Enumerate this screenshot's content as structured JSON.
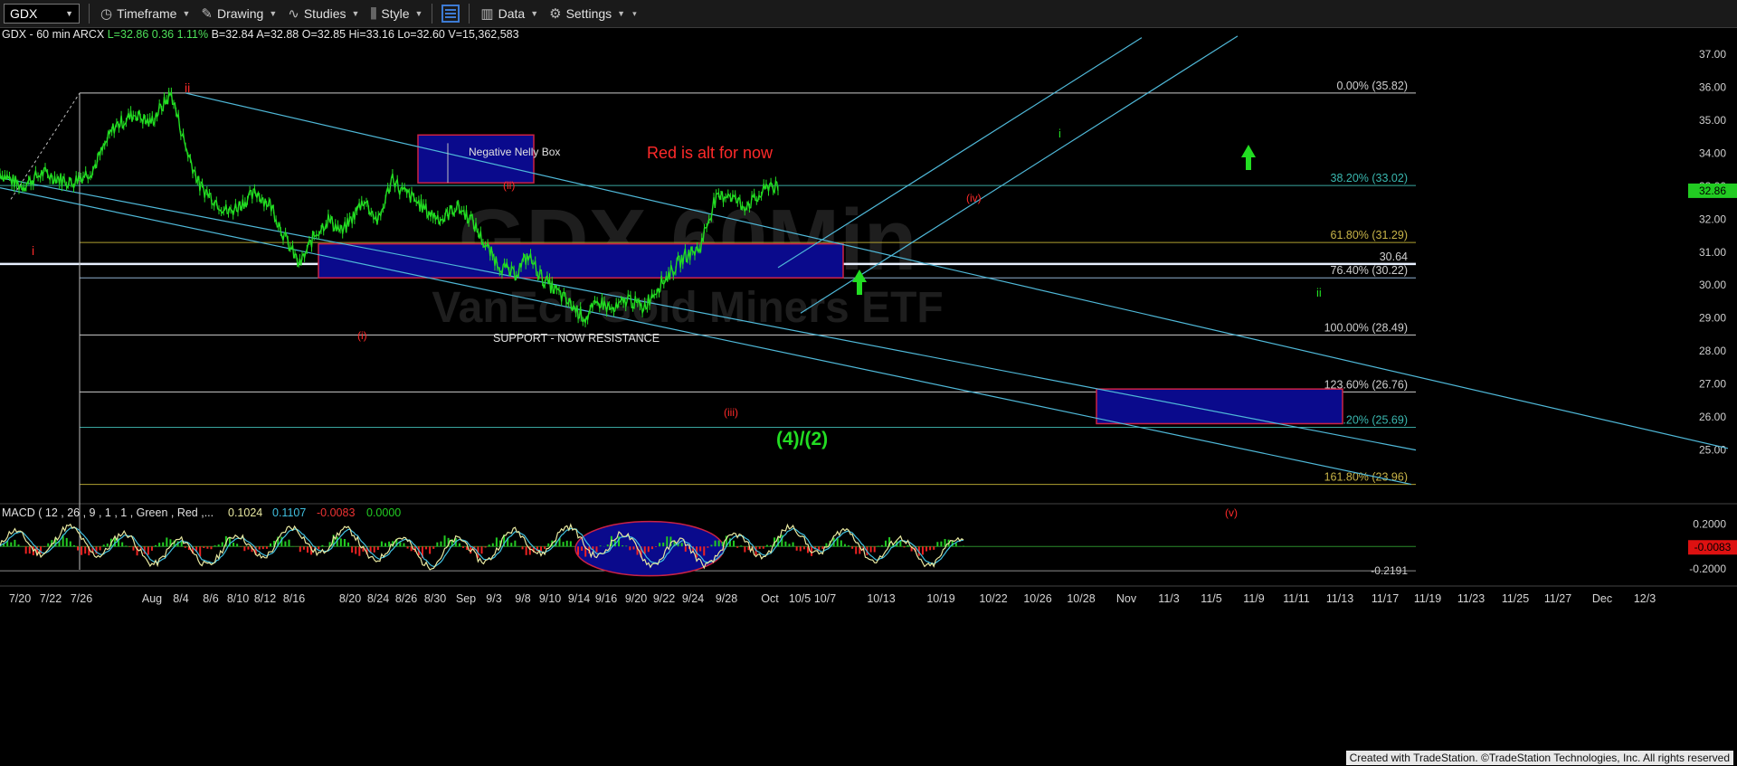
{
  "toolbar": {
    "symbol": "GDX",
    "timeframe": "Timeframe",
    "drawing": "Drawing",
    "studies": "Studies",
    "style": "Style",
    "data": "Data",
    "settings": "Settings"
  },
  "header": {
    "instrument": "GDX - 60 min",
    "exchange": "ARCX",
    "last": "L=32.86",
    "change": "0.36",
    "pct": "1.11%",
    "bid": "B=32.84",
    "ask": "A=32.88",
    "open": "O=32.85",
    "high": "Hi=33.16",
    "low": "Lo=32.60",
    "volume": "V=15,362,583"
  },
  "colors": {
    "price": "#22dd22",
    "wave_red": "#ff2a2a",
    "wave_green": "#22dd22",
    "channel": "#4fb8d8",
    "box_fill": "#0a0a8c",
    "box_border": "#cc2244",
    "macd_hist_pos": "#22cc22",
    "macd_hist_neg": "#ee2222",
    "macd_line": "#e8e8a0",
    "signal_line": "#40c0e0"
  },
  "watermark": {
    "line1": "GDX 60Min",
    "line2": "VanEck Gold Miners ETF"
  },
  "chart_data": {
    "type": "line",
    "title": "GDX - 60 min",
    "ylim": [
      23.4,
      37.6
    ],
    "y_ticks": [
      "37.00",
      "36.00",
      "35.00",
      "34.00",
      "33.00",
      "32.00",
      "31.00",
      "30.00",
      "29.00",
      "28.00",
      "27.00",
      "26.00",
      "25.00"
    ],
    "x_labels": [
      "7/20",
      "7/22",
      "7/26",
      "Aug",
      "8/4",
      "8/6",
      "8/10",
      "8/12",
      "8/16",
      "8/20",
      "8/24",
      "8/26",
      "8/30",
      "Sep",
      "9/3",
      "9/8",
      "9/10",
      "9/14",
      "9/16",
      "9/20",
      "9/22",
      "9/24",
      "9/28",
      "Oct",
      "10/5",
      "10/7",
      "10/13",
      "10/19",
      "10/22",
      "10/26",
      "10/28",
      "Nov",
      "11/3",
      "11/5",
      "11/9",
      "11/11",
      "11/13",
      "11/17",
      "11/19",
      "11/23",
      "11/25",
      "11/27",
      "Dec",
      "12/3"
    ],
    "price_series": {
      "name": "GDX",
      "anchors": [
        [
          0,
          33.4
        ],
        [
          1.5,
          33.0
        ],
        [
          3,
          33.4
        ],
        [
          5,
          33.1
        ],
        [
          6.5,
          33.5
        ],
        [
          8,
          34.8
        ],
        [
          9.5,
          35.2
        ],
        [
          10.5,
          34.9
        ],
        [
          11.5,
          35.5
        ],
        [
          12,
          35.8
        ],
        [
          13,
          34.2
        ],
        [
          14,
          33.0
        ],
        [
          16,
          32.2
        ],
        [
          18,
          32.8
        ],
        [
          19,
          32.4
        ],
        [
          20,
          31.4
        ],
        [
          21,
          30.6
        ],
        [
          22,
          31.5
        ],
        [
          23,
          32.0
        ],
        [
          24,
          31.6
        ],
        [
          25.5,
          32.6
        ],
        [
          26.5,
          31.9
        ],
        [
          27.5,
          33.3
        ],
        [
          28,
          32.9
        ],
        [
          29,
          32.6
        ],
        [
          30,
          32.2
        ],
        [
          31,
          32.0
        ],
        [
          32,
          32.4
        ],
        [
          33,
          32.0
        ],
        [
          34,
          31.2
        ],
        [
          35,
          30.6
        ],
        [
          36,
          30.3
        ],
        [
          37,
          30.9
        ],
        [
          38,
          30.2
        ],
        [
          39,
          29.8
        ],
        [
          40,
          29.4
        ],
        [
          41,
          29.0
        ],
        [
          42,
          29.5
        ],
        [
          43,
          29.2
        ],
        [
          44,
          29.6
        ],
        [
          45,
          29.3
        ],
        [
          46,
          29.9
        ],
        [
          47,
          30.4
        ],
        [
          48,
          30.9
        ],
        [
          49,
          31.1
        ],
        [
          50,
          32.5
        ],
        [
          51,
          32.8
        ],
        [
          52,
          32.4
        ],
        [
          53,
          32.6
        ],
        [
          54,
          33.1
        ],
        [
          54.5,
          32.86
        ]
      ],
      "last": "32.86"
    },
    "horizontal_levels": [
      {
        "label": "0.00% (35.82)",
        "value": 35.82,
        "color": "#cccccc"
      },
      {
        "label": "38.20% (33.02)",
        "value": 33.02,
        "color": "#3aa6a0"
      },
      {
        "label": "61.80% (31.29)",
        "value": 31.29,
        "color": "#b0a030"
      },
      {
        "label": "30.64",
        "value": 30.64,
        "color": "#e8f0ff"
      },
      {
        "label": "76.40% (30.22)",
        "value": 30.22,
        "color": "#8fb0d0"
      },
      {
        "label": "100.00% (28.49)",
        "value": 28.49,
        "color": "#cccccc"
      },
      {
        "label": "123.60% (26.76)",
        "value": 26.76,
        "color": "#cccccc"
      },
      {
        "label": "138.20% (25.69)",
        "value": 25.69,
        "color": "#3aa6a0"
      },
      {
        "label": "161.80% (23.96)",
        "value": 23.96,
        "color": "#b0a030"
      }
    ],
    "annotations": [
      {
        "text": "Red is alt for now",
        "color": "#ff2a2a"
      },
      {
        "text": "Negative Nelly Box",
        "color": "#e0e0e0"
      },
      {
        "text": "SUPPORT -  NOW RESISTANCE",
        "color": "#e0e0e0"
      },
      {
        "text": "(4)/(2)",
        "color": "#22dd22"
      },
      {
        "text": "i",
        "color": "#ff2a2a"
      },
      {
        "text": "ii",
        "color": "#ff2a2a"
      },
      {
        "text": "(i)",
        "color": "#ff2a2a"
      },
      {
        "text": "(ii)",
        "color": "#ff2a2a"
      },
      {
        "text": "(iii)",
        "color": "#ff2a2a"
      },
      {
        "text": "(iv)",
        "color": "#ff2a2a"
      },
      {
        "text": "(v)",
        "color": "#ff2a2a"
      },
      {
        "text": "i",
        "color": "#22dd22"
      },
      {
        "text": "ii",
        "color": "#22dd22"
      }
    ],
    "macd": {
      "label": "MACD ( 12 , 26 , 9 , 1 , 1 , Green , Red ,...",
      "macd": "0.1024",
      "signal": "0.1107",
      "diff": "-0.0083",
      "zero": "0.0000",
      "y_ticks": [
        "0.2000",
        "-0.2000"
      ],
      "level_label": "-0.2191",
      "last_label": "-0.0083",
      "ylim": [
        -0.34,
        0.36
      ]
    }
  },
  "footer": "Created with TradeStation. ©TradeStation Technologies, Inc. All rights reserved"
}
